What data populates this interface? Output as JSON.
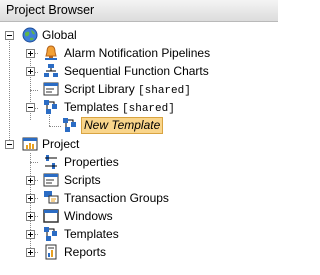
{
  "panel": {
    "title": "Project Browser"
  },
  "tree": {
    "global": {
      "label": "Global",
      "children": {
        "alarm_pipelines": "Alarm Notification Pipelines",
        "sfc": "Sequential Function Charts",
        "script_library": {
          "label": "Script Library ",
          "suffix": "[shared]"
        },
        "templates": {
          "label": "Templates ",
          "suffix": "[shared]"
        },
        "new_template": "New Template"
      }
    },
    "project": {
      "label": "Project",
      "children": {
        "properties": "Properties",
        "scripts": "Scripts",
        "transaction_groups": "Transaction Groups",
        "windows": "Windows",
        "templates": "Templates",
        "reports": "Reports"
      }
    }
  },
  "colors": {
    "selection_bg": "#f9d58b",
    "selection_border": "#d9a441"
  }
}
